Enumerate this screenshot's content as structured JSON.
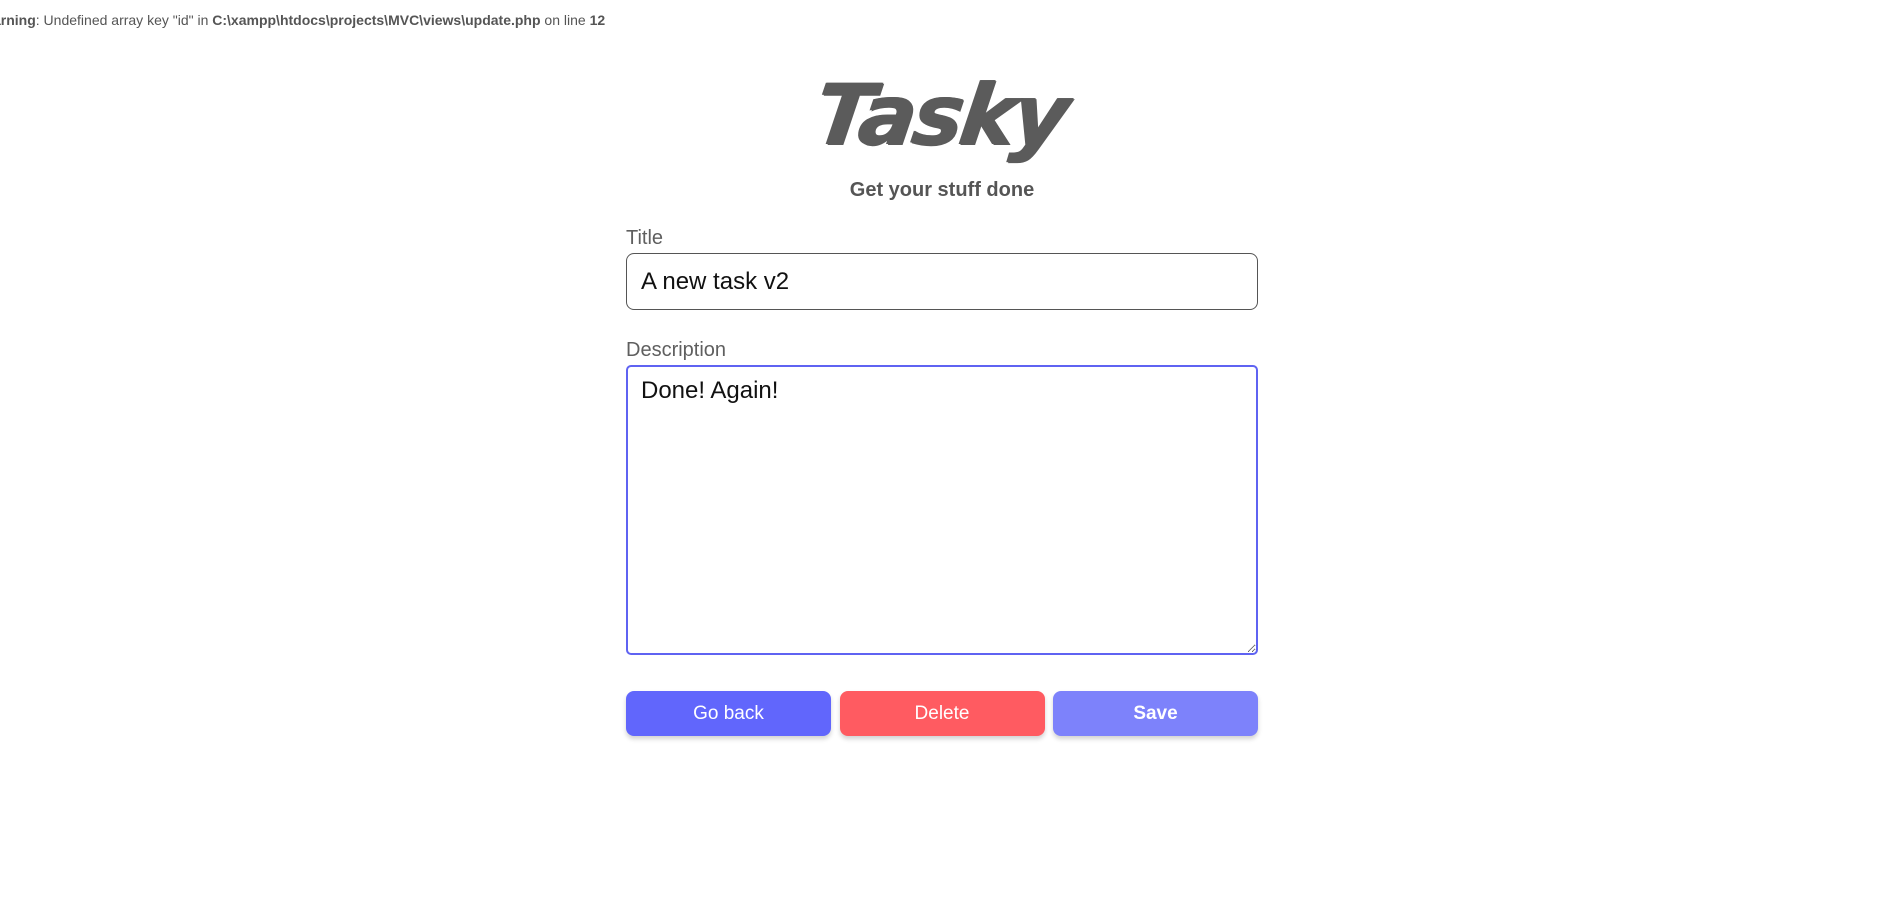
{
  "warning": {
    "prefix": "arning",
    "message": ": Undefined array key \"id\" in ",
    "file": "C:\\xampp\\htdocs\\projects\\MVC\\views\\update.php",
    "on_line": " on line ",
    "line": "12"
  },
  "brand": {
    "logo": "Tasky",
    "tagline": "Get your stuff done"
  },
  "form": {
    "title_label": "Title",
    "title_value": "A new task v2",
    "description_label": "Description",
    "description_value": "Done! Again!"
  },
  "buttons": {
    "back": "Go back",
    "delete": "Delete",
    "save": "Save"
  },
  "colors": {
    "back": "#6166fc",
    "delete": "#ff5b61",
    "save": "#7d82fb",
    "focus_border": "#5f63f2"
  }
}
